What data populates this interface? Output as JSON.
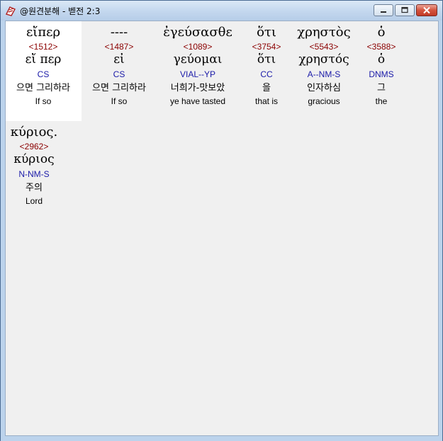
{
  "window": {
    "title": "@원견분해 - 벧전 2:3"
  },
  "words": [
    {
      "greek": "εἴπερ",
      "strong": "<1512>",
      "lemma": "εἴ περ",
      "morph": "CS",
      "korean": "으면 그리하라",
      "english": "If so"
    },
    {
      "greek": "----",
      "strong": "<1487>",
      "lemma": "εἰ",
      "morph": "CS",
      "korean": "으면 그리하라",
      "english": "If so"
    },
    {
      "greek": "ἐγεύσασθε",
      "strong": "<1089>",
      "lemma": "γεύομαι",
      "morph": "VIAL--YP",
      "korean": "너희가-맛보았",
      "english": "ye have tasted"
    },
    {
      "greek": "ὅτι",
      "strong": "<3754>",
      "lemma": "ὅτι",
      "morph": "CC",
      "korean": "을",
      "english": "that is"
    },
    {
      "greek": "χρηστὸς",
      "strong": "<5543>",
      "lemma": "χρηστός",
      "morph": "A--NM-S",
      "korean": "인자하심",
      "english": "gracious"
    },
    {
      "greek": "ὁ",
      "strong": "<3588>",
      "lemma": "ὁ",
      "morph": "DNMS",
      "korean": "그",
      "english": "the"
    },
    {
      "greek": "κύριος.",
      "strong": "<2962>",
      "lemma": "κύριος",
      "morph": "N-NM-S",
      "korean": "주의",
      "english": "Lord"
    }
  ]
}
